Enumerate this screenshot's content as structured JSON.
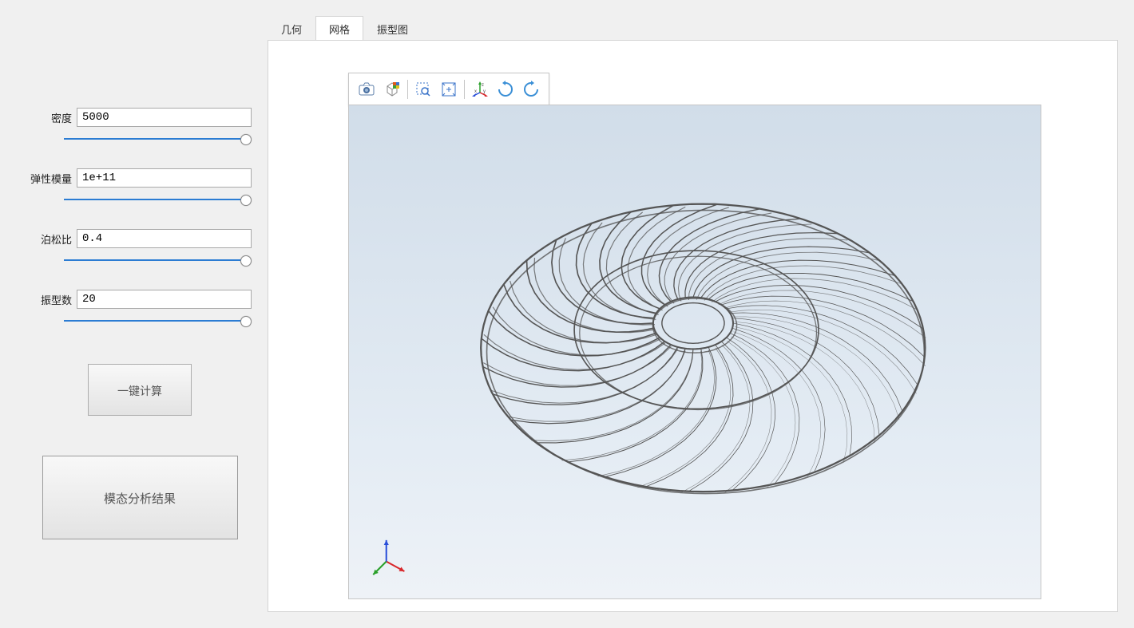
{
  "params": {
    "density": {
      "label": "密度",
      "value": "5000"
    },
    "elastic": {
      "label": "弹性模量",
      "value": "1e+11"
    },
    "poisson": {
      "label": "泊松比",
      "value": "0.4"
    },
    "modes": {
      "label": "振型数",
      "value": "20"
    }
  },
  "buttons": {
    "compute": "一键计算",
    "results": "模态分析结果"
  },
  "tabs": [
    {
      "id": "geometry",
      "label": "几何",
      "active": false
    },
    {
      "id": "mesh",
      "label": "网格",
      "active": true
    },
    {
      "id": "modeshape",
      "label": "振型图",
      "active": false
    }
  ],
  "toolbar_icons": [
    "camera-icon",
    "cube-icon",
    "sep",
    "zoom-select-icon",
    "fit-icon",
    "sep",
    "axis-icon",
    "rotate-cw-icon",
    "rotate-ccw-icon"
  ],
  "colors": {
    "axis_x": "#d9262a",
    "axis_y": "#2aa02a",
    "axis_z": "#2a4fd9",
    "accent": "#2b7cd3",
    "mesh_line": "#555555"
  }
}
